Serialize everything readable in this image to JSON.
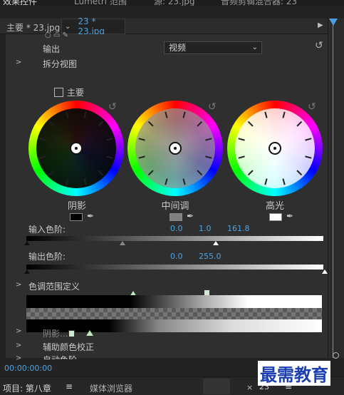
{
  "top_tabs": [
    "效果控件",
    "Lumetri 范围",
    "源: 23.jpg",
    "音频剪辑混合器: 23"
  ],
  "clip_bar": {
    "master_label": "主要 * 23.jpg",
    "sequence_label": "23 * 23.jpg"
  },
  "output": {
    "label": "输出",
    "value": "视频"
  },
  "split_view": {
    "label": "拆分视图"
  },
  "master_checkbox": {
    "label": "主要",
    "checked": false
  },
  "wheels": [
    {
      "label": "阴影",
      "swatch_color": "#000000"
    },
    {
      "label": "中间调",
      "swatch_color": "#808080"
    },
    {
      "label": "高光",
      "swatch_color": "#ffffff"
    }
  ],
  "input_levels": {
    "label": "输入色阶:",
    "values": [
      "0.0",
      "1.0",
      "161.8"
    ]
  },
  "output_levels": {
    "label": "输出色阶:",
    "values": [
      "0.0",
      "255.0"
    ]
  },
  "tonal_range": {
    "label": "色调范围定义"
  },
  "sections": [
    {
      "label": "阴影..."
    },
    {
      "label": "辅助颜色校正"
    },
    {
      "label": "自动色阶"
    }
  ],
  "timecode": "00:00:00:00",
  "bottom": {
    "project_label": "项目: 第八章",
    "media_browser": "媒体浏览器",
    "timeline_tab": "23"
  },
  "watermark": "最需教育",
  "colors": {
    "accent": "#4ea3e0",
    "panel_bg": "#2f2f2f"
  }
}
